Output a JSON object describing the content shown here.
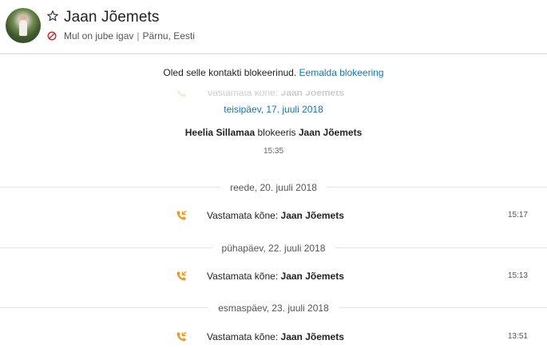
{
  "header": {
    "contact_name": "Jaan Jõemets",
    "mood": "Mul on jube igav",
    "separator": "|",
    "location": "Pärnu, Eesti"
  },
  "blocked_bar": {
    "message": "Oled selle kontakti blokeerinud.",
    "unblock_link": "Eemalda blokeering"
  },
  "messages": {
    "ghost_call": {
      "label": "Vastamata kõne:",
      "name": "Jaan Jõemets"
    },
    "date_1": "teisipäev, 17. juuli 2018",
    "system_event": {
      "actor": "Heelia Sillamaa",
      "verb": "blokeeris",
      "target": "Jaan Jõemets",
      "time": "15:35"
    },
    "date_2": "reede, 20. juuli 2018",
    "call_1": {
      "label": "Vastamata kõne:",
      "name": "Jaan Jõemets",
      "time": "15:17"
    },
    "date_3": "pühapäev, 22. juuli 2018",
    "call_2": {
      "label": "Vastamata kõne:",
      "name": "Jaan Jõemets",
      "time": "15:13"
    },
    "date_4": "esmaspäev, 23. juuli 2018",
    "call_3": {
      "label": "Vastamata kõne:",
      "name": "Jaan Jõemets",
      "time": "13:51"
    }
  },
  "colors": {
    "link": "#0f78b4",
    "missed_call": "#f7941e",
    "blocked": "#e0202a"
  },
  "icons": {
    "favorite": "star-outline-icon",
    "blocked": "blocked-icon",
    "missed_call": "missed-call-icon"
  }
}
